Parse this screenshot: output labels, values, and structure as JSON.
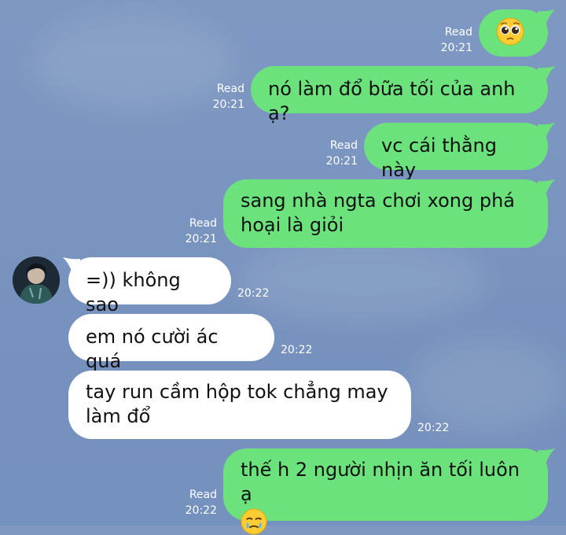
{
  "colors": {
    "outgoing_bubble": "#6be27b",
    "incoming_bubble": "#ffffff",
    "meta_text": "#ffffff"
  },
  "messages": [
    {
      "id": "m1",
      "direction": "out",
      "lines": [],
      "emoji": "pleading-face",
      "status": "Read",
      "time": "20:21"
    },
    {
      "id": "m2",
      "direction": "out",
      "lines": [
        "nó làm đổ bữa tối của anh ạ?"
      ],
      "status": "Read",
      "time": "20:21"
    },
    {
      "id": "m3",
      "direction": "out",
      "lines": [
        "vc cái thằng này"
      ],
      "status": "Read",
      "time": "20:21"
    },
    {
      "id": "m4",
      "direction": "out",
      "lines": [
        "sang nhà ngta chơi xong phá",
        "hoại là giỏi"
      ],
      "status": "Read",
      "time": "20:21"
    },
    {
      "id": "m5",
      "direction": "in",
      "lines": [
        "=)) không sao"
      ],
      "time": "20:22",
      "avatar": "contact-avatar"
    },
    {
      "id": "m6",
      "direction": "in",
      "lines": [
        "em nó cười ác quá"
      ],
      "time": "20:22"
    },
    {
      "id": "m7",
      "direction": "in",
      "lines": [
        "tay run cầm hộp tok chẳng may",
        "làm đổ"
      ],
      "time": "20:22"
    },
    {
      "id": "m8",
      "direction": "out",
      "lines": [
        "thế h 2 người nhịn ăn tối luôn ạ"
      ],
      "emoji": "face-holding-back-tears",
      "status": "Read",
      "time": "20:22"
    }
  ]
}
